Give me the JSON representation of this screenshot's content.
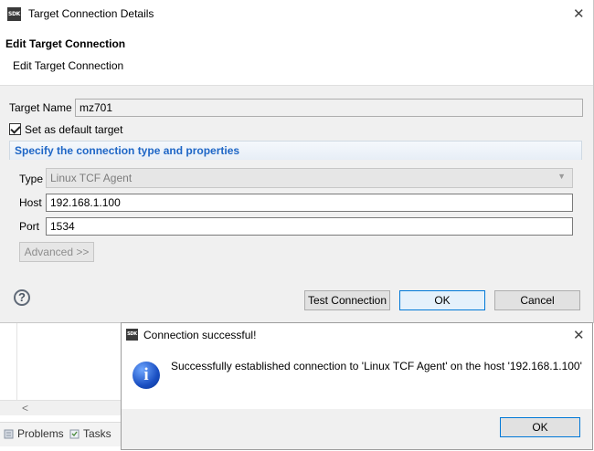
{
  "background": {
    "scroll_left_arrow": "<",
    "tabs": [
      {
        "label": "Problems"
      },
      {
        "label": "Tasks"
      }
    ]
  },
  "dialog": {
    "app_icon_text": "SDK",
    "title": "Target Connection Details",
    "banner_title": "Edit Target Connection",
    "banner_subtitle": "Edit Target Connection",
    "target_name_label": "Target Name",
    "target_name_value": "mz701",
    "default_checkbox_label": "Set as default target",
    "group_title": "Specify the connection type and properties",
    "type_label": "Type",
    "type_value": "Linux TCF Agent",
    "host_label": "Host",
    "host_value": "192.168.1.100",
    "port_label": "Port",
    "port_value": "1534",
    "advanced_button": "Advanced >>",
    "test_button": "Test Connection",
    "ok_button": "OK",
    "cancel_button": "Cancel",
    "help_glyph": "?"
  },
  "popup": {
    "app_icon_text": "SDK",
    "title": "Connection successful!",
    "message": "Successfully established connection to 'Linux TCF Agent' on the host '192.168.1.100'",
    "info_glyph": "i",
    "ok_button": "OK"
  },
  "colors": {
    "accent_blue": "#1e66c6",
    "default_button_border": "#0078d7"
  }
}
